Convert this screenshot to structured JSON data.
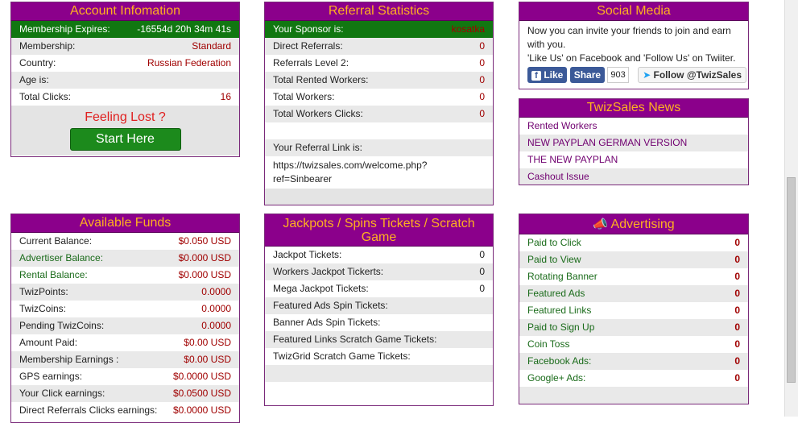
{
  "account": {
    "title": "Account Infomation",
    "rows": [
      {
        "label": "Membership Expires:",
        "value": "-16554d 20h 34m 41s"
      },
      {
        "label": "Membership:",
        "value": "Standard"
      },
      {
        "label": "Country:",
        "value": "Russian Federation"
      },
      {
        "label": "Age is:",
        "value": ""
      },
      {
        "label": "Total Clicks:",
        "value": "16"
      }
    ],
    "feeling_lost": "Feeling Lost ?",
    "start_label": "Start Here"
  },
  "referral": {
    "title": "Referral Statistics",
    "rows": [
      {
        "label": "Your Sponsor is:",
        "value": "kosatka"
      },
      {
        "label": "Direct Referrals:",
        "value": "0"
      },
      {
        "label": "Referrals Level 2:",
        "value": "0"
      },
      {
        "label": "Total Rented Workers:",
        "value": "0"
      },
      {
        "label": "Total Workers:",
        "value": "0"
      },
      {
        "label": "Total Workers Clicks:",
        "value": "0"
      }
    ],
    "link_label": "Your Referral Link is:",
    "link_url_1": "https://twizsales.com/welcome.php?",
    "link_url_2": "ref=Sinbearer"
  },
  "social": {
    "title": "Social Media",
    "text_1": "Now you can invite your friends to join and earn with you.",
    "text_2": "'Like Us' on Facebook and 'Follow Us' on Twiiter.",
    "like_label": "Like",
    "share_label": "Share",
    "share_count": "903",
    "follow_label": "Follow @TwizSales"
  },
  "news": {
    "title": "TwizSales News",
    "items": [
      "Rented Workers",
      "NEW PAYPLAN GERMAN VERSION",
      "THE NEW PAYPLAN",
      "Cashout Issue"
    ]
  },
  "funds": {
    "title": "Available Funds",
    "rows": [
      {
        "label": "Current Balance:",
        "value": "$0.050 USD"
      },
      {
        "label": "Advertiser Balance:",
        "value": "$0.000 USD"
      },
      {
        "label": "Rental Balance:",
        "value": "$0.000 USD"
      },
      {
        "label": "TwizPoints:",
        "value": "0.0000"
      },
      {
        "label": "TwizCoins:",
        "value": "0.0000"
      },
      {
        "label": "Pending TwizCoins:",
        "value": "0.0000"
      },
      {
        "label": "Amount Paid:",
        "value": "$0.00 USD"
      },
      {
        "label": "Membership Earnings :",
        "value": "$0.00 USD"
      },
      {
        "label": "GPS earnings:",
        "value": "$0.0000 USD"
      },
      {
        "label": "Your Click earnings:",
        "value": "$0.0500 USD"
      },
      {
        "label": "Direct Referrals Clicks earnings:",
        "value": "$0.0000 USD"
      }
    ]
  },
  "jackpots": {
    "title": "Jackpots / Spins Tickets / Scratch Game",
    "rows": [
      {
        "label": "Jackpot Tickets:",
        "value": "0"
      },
      {
        "label": "Workers Jackpot Tickerts:",
        "value": "0"
      },
      {
        "label": "Mega Jackpot Tickets:",
        "value": "0"
      },
      {
        "label": "Featured Ads Spin Tickets:",
        "value": ""
      },
      {
        "label": "Banner Ads Spin Tickets:",
        "value": ""
      },
      {
        "label": "Featured Links Scratch Game Tickets:",
        "value": ""
      },
      {
        "label": "TwizGrid Scratch Game Tickets:",
        "value": ""
      }
    ]
  },
  "advertising": {
    "title": "Advertising",
    "rows": [
      {
        "label": "Paid to Click",
        "value": "0"
      },
      {
        "label": "Paid to View",
        "value": "0"
      },
      {
        "label": "Rotating Banner",
        "value": "0"
      },
      {
        "label": "Featured Ads",
        "value": "0"
      },
      {
        "label": "Featured Links",
        "value": "0"
      },
      {
        "label": "Paid to Sign Up",
        "value": "0"
      },
      {
        "label": "Coin Toss",
        "value": "0"
      },
      {
        "label": "Facebook Ads:",
        "value": "0"
      },
      {
        "label": "Google+ Ads:",
        "value": "0"
      }
    ]
  },
  "colors": {
    "header_bg": "#8b008b",
    "header_text": "#ffb020",
    "accent_green": "#117711",
    "value_red": "#a00000"
  }
}
